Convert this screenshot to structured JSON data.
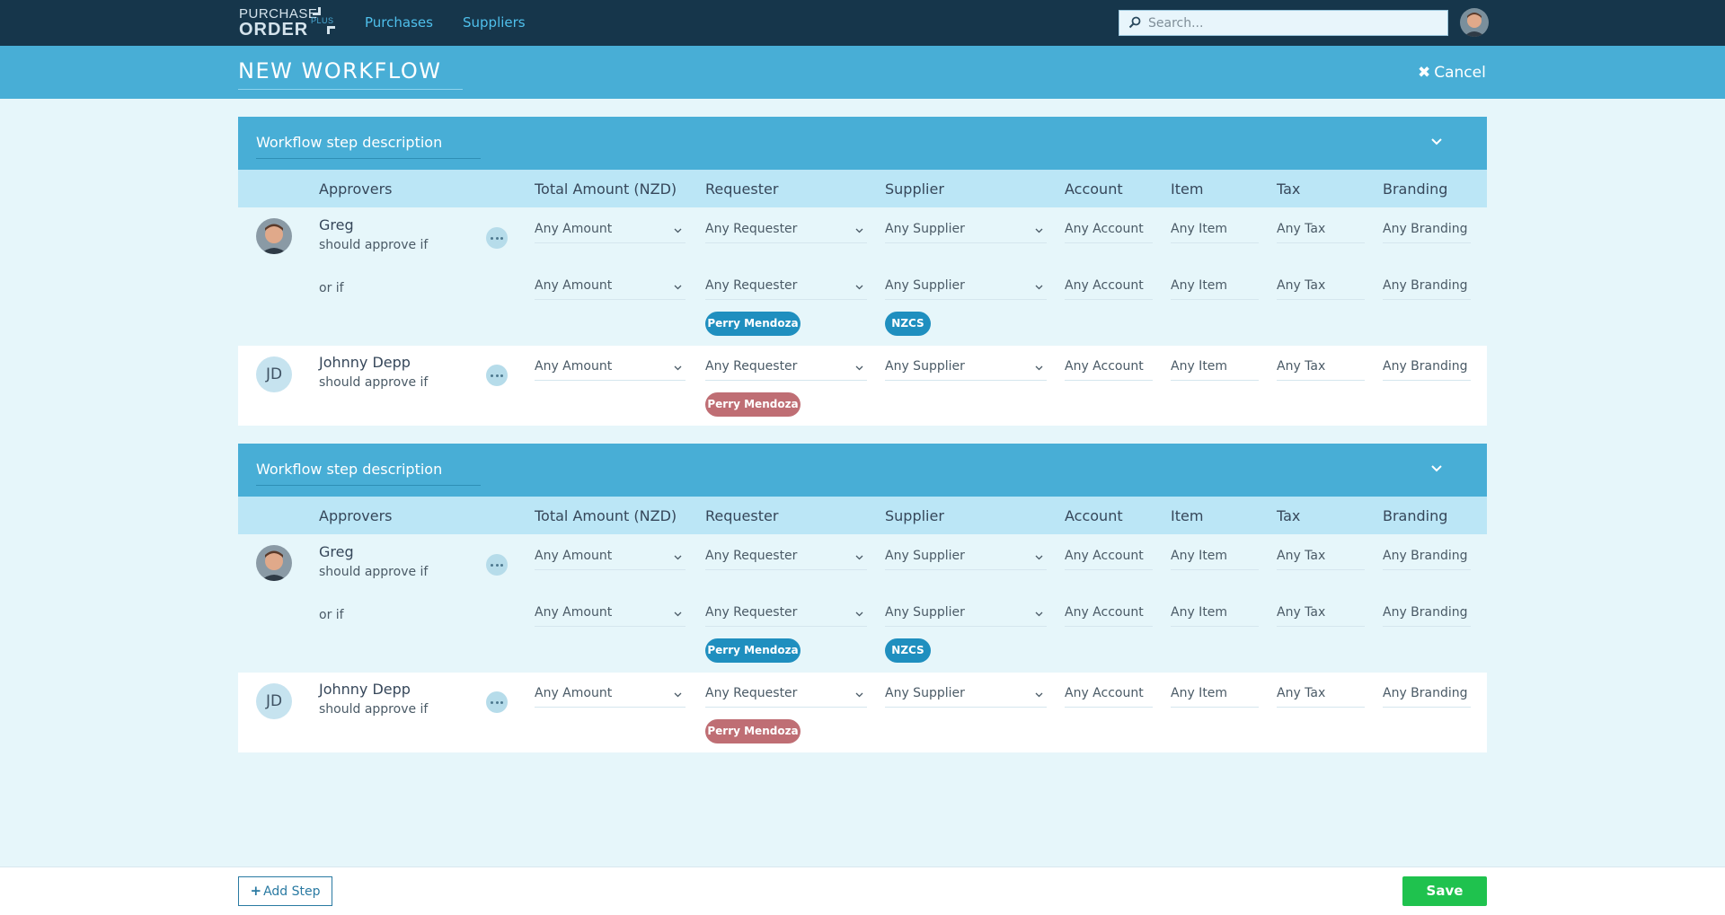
{
  "app": {
    "logo_line1": "PURCHASE",
    "logo_line2": "ORDER",
    "logo_plus": "PLUS",
    "nav": [
      "Purchases",
      "Suppliers"
    ],
    "search_placeholder": "Search..."
  },
  "header": {
    "title": "NEW WORKFLOW",
    "cancel_label": "Cancel",
    "cancel_icon": "close-icon"
  },
  "columns": [
    "Approvers",
    "Total Amount (NZD)",
    "Requester",
    "Supplier",
    "Account",
    "Item",
    "Tax",
    "Branding"
  ],
  "steps": [
    {
      "description": "Workflow step description",
      "approvers": [
        {
          "name": "Greg",
          "subtitle": "should approve if",
          "or_label": "or if",
          "rules": [
            {
              "amount": "Any Amount",
              "requester": "Any Requester",
              "supplier": "Any Supplier",
              "account": "Any Account",
              "item": "Any Item",
              "tax": "Any Tax",
              "branding": "Any Branding"
            },
            {
              "amount": "Any Amount",
              "requester": "Any Requester",
              "supplier": "Any Supplier",
              "account": "Any Account",
              "item": "Any Item",
              "tax": "Any Tax",
              "branding": "Any Branding",
              "requester_tag": "Perry Mendoza",
              "supplier_tag": "NZCS"
            }
          ]
        },
        {
          "name": "Johnny Depp",
          "initials": "JD",
          "subtitle": "should approve if",
          "rules": [
            {
              "amount": "Any Amount",
              "requester": "Any Requester",
              "supplier": "Any Supplier",
              "account": "Any Account",
              "item": "Any Item",
              "tax": "Any Tax",
              "branding": "Any Branding",
              "requester_tag": "Perry Mendoza"
            }
          ]
        }
      ]
    },
    {
      "description": "Workflow step description",
      "approvers": [
        {
          "name": "Greg",
          "subtitle": "should approve if",
          "or_label": "or if",
          "rules": [
            {
              "amount": "Any Amount",
              "requester": "Any Requester",
              "supplier": "Any Supplier",
              "account": "Any Account",
              "item": "Any Item",
              "tax": "Any Tax",
              "branding": "Any Branding"
            },
            {
              "amount": "Any Amount",
              "requester": "Any Requester",
              "supplier": "Any Supplier",
              "account": "Any Account",
              "item": "Any Item",
              "tax": "Any Tax",
              "branding": "Any Branding",
              "requester_tag": "Perry Mendoza",
              "supplier_tag": "NZCS"
            }
          ]
        },
        {
          "name": "Johnny Depp",
          "initials": "JD",
          "subtitle": "should approve if",
          "rules": [
            {
              "amount": "Any Amount",
              "requester": "Any Requester",
              "supplier": "Any Supplier",
              "account": "Any Account",
              "item": "Any Item",
              "tax": "Any Tax",
              "branding": "Any Branding",
              "requester_tag": "Perry Mendoza"
            }
          ]
        }
      ]
    }
  ],
  "footer": {
    "add_step_label": "Add Step",
    "save_label": "Save"
  },
  "colors": {
    "nav_bg": "#16364b",
    "accent": "#48aed6",
    "column_header": "#bbe6f6",
    "save_green": "#1fc24e",
    "tag_blue": "#1f8fbf",
    "tag_red": "#bf6e74"
  }
}
